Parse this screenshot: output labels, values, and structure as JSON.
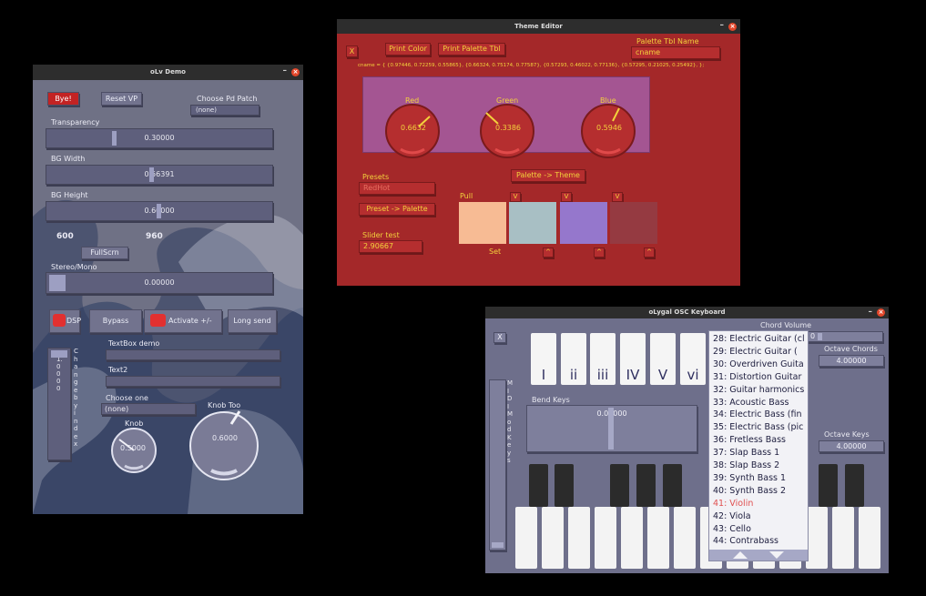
{
  "olv": {
    "title": "oLv Demo",
    "bye": "Bye!",
    "reset_vp": "Reset VP",
    "choose_patch": "Choose Pd Patch",
    "patch_value": "(none)",
    "transparency_label": "Transparency",
    "transparency_value": "0.30000",
    "bgwidth_label": "BG Width",
    "bgwidth_value": "0.56391",
    "bgheight_label": "BG Height",
    "bgheight_value": "0.60000",
    "size_w": "600",
    "size_h": "960",
    "fullscrn": "FullScrn",
    "stereo_label": "Stereo/Mono",
    "stereo_value": "0.00000",
    "dsp": "DSP",
    "bypass": "Bypass",
    "activate": "Activate +/-",
    "long_send": "Long send",
    "textbox_label": "TextBox demo",
    "text2_label": "Text2",
    "vslider_value": "1.0000",
    "vslider_caption": "Change by index",
    "choose_one_label": "Choose one",
    "choose_one_value": "(none)",
    "knob_label": "Knob",
    "knob_value": "0.5000",
    "knob_too_label": "Knob Too",
    "knob_too_value": "0.6000"
  },
  "theme": {
    "title": "Theme Editor",
    "x": "X",
    "print_color": "Print Color",
    "print_palette": "Print Palette Tbl",
    "palette_name_label": "Palette Tbl Name",
    "palette_name_value": "cname",
    "cname_line": "cname = { {0.97446, 0.72259, 0.55865}, {0.66324, 0.75174, 0.77587}, {0.57293, 0.46022, 0.77136}, {0.57295, 0.21025, 0.25492}, };",
    "red_label": "Red",
    "red_value": "0.6632",
    "green_label": "Green",
    "green_value": "0.3386",
    "blue_label": "Blue",
    "blue_value": "0.5946",
    "presets_label": "Presets",
    "presets_value": "RedHot",
    "palette_to_theme": "Palette -> Theme",
    "preset_to_palette": "Preset -> Palette",
    "slider_test_label": "Slider test",
    "slider_test_value": "2.90667",
    "pull": "Pull",
    "v": "V",
    "set": "Set",
    "up": "^",
    "swatch_colors": [
      "#f7bb94",
      "#a8bfc4",
      "#9577cc",
      "#953a41"
    ]
  },
  "keyboard": {
    "title": "oLygal OSC Keyboard",
    "x": "X",
    "chord_volume_label": "Chord Volume",
    "chord_volume_value": "0",
    "octave_chords_label": "Octave Chords",
    "octave_chords_value": "4.00000",
    "octave_keys_label": "Octave Keys",
    "octave_keys_value": "4.00000",
    "chords": [
      "I",
      "ii",
      "iii",
      "IV",
      "V",
      "vi"
    ],
    "midi_mod_keys": "MIDI Mod Keys",
    "bend_label": "Bend Keys",
    "bend_value": "0.00000",
    "instruments": [
      "28: Electric Guitar (cl",
      "29: Electric Guitar (",
      "30: Overdriven Guita",
      "31: Distortion Guitar",
      "32: Guitar harmonics",
      "33: Acoustic Bass",
      "34: Electric Bass (fin",
      "35: Electric Bass (pic",
      "36: Fretless Bass",
      "37: Slap Bass 1",
      "38: Slap Bass 2",
      "39: Synth Bass 1",
      "40: Synth Bass 2",
      "41: Violin",
      "42: Viola",
      "43: Cello",
      "44: Contrabass"
    ],
    "selected_instrument": "41: Violin"
  },
  "colors": {
    "theme_red": "#a42829",
    "theme_yellow": "#f3d23c",
    "olv_bg": "#6b6d80",
    "keyboard_bg": "#6e6f8b",
    "selected_item": "#e05050"
  }
}
